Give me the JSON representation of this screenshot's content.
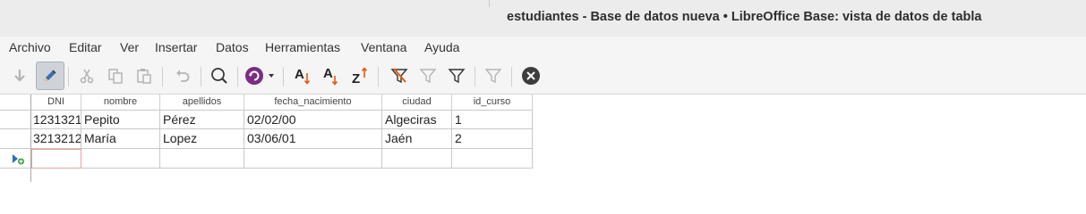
{
  "window": {
    "title": "estudiantes - Base de datos nueva • LibreOffice Base: vista de datos de tabla"
  },
  "menu": {
    "items": [
      {
        "label": "Archivo"
      },
      {
        "label": "Editar"
      },
      {
        "label": "Ver"
      },
      {
        "label": "Insertar"
      },
      {
        "label": "Datos"
      },
      {
        "label": "Herramientas"
      },
      {
        "label": "Ventana"
      },
      {
        "label": "Ayuda"
      }
    ]
  },
  "toolbar": {
    "sort_asc_letter": "A",
    "sort_desc_letter": "A",
    "sort_z_letter": "Z",
    "accent_orange": "#e8590c",
    "accent_purple": "#7b2c83",
    "icons": [
      "save-record-icon",
      "edit-data-icon",
      "cut-icon",
      "copy-icon",
      "paste-icon",
      "undo-icon",
      "find-record-icon",
      "refresh-icon",
      "sort-ascending-icon",
      "sort-descending-icon",
      "sort-icon",
      "autofilter-icon",
      "standard-filter-icon",
      "apply-filter-icon",
      "remove-filter-icon",
      "close-icon"
    ]
  },
  "table": {
    "columns": [
      "DNI",
      "nombre",
      "apellidos",
      "fecha_nacimiento",
      "ciudad",
      "id_curso"
    ],
    "rows": [
      [
        "1231321",
        "Pepito",
        "Pérez",
        "02/02/00",
        "Algeciras",
        "1"
      ],
      [
        "3213212",
        "María",
        "Lopez",
        "03/06/01",
        "Jaén",
        "2"
      ]
    ],
    "new_row_cells": [
      "",
      "",
      "",
      "",
      "",
      ""
    ]
  }
}
